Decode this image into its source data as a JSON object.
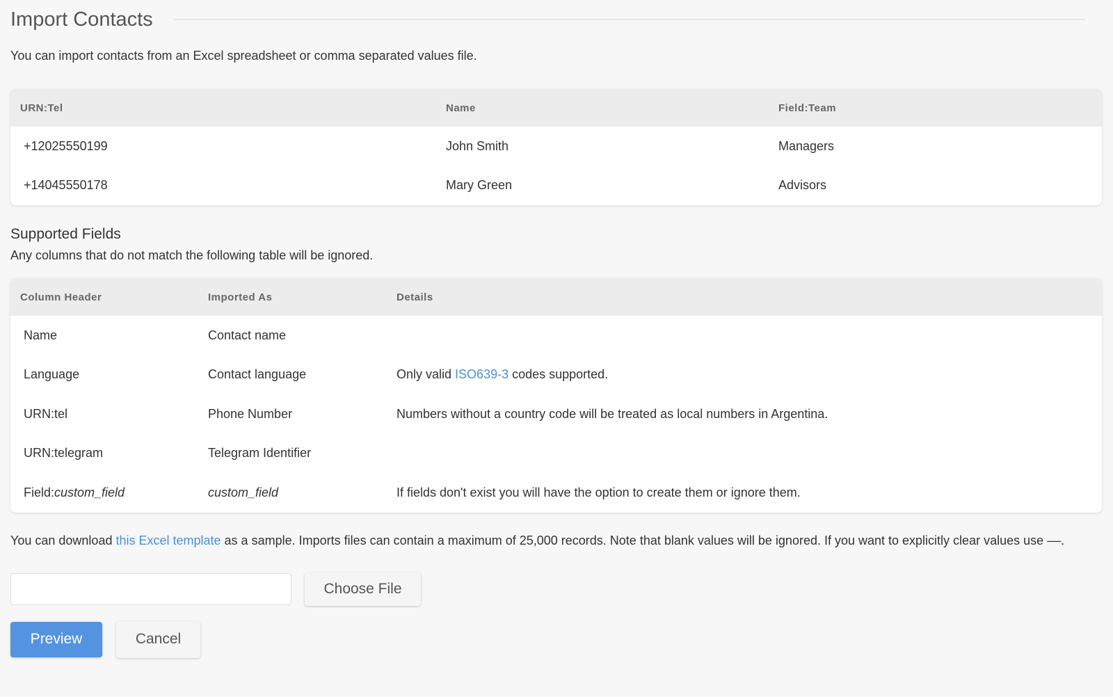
{
  "header": {
    "title": "Import Contacts",
    "intro": "You can import contacts from an Excel spreadsheet or comma separated values file."
  },
  "sample_table": {
    "columns": [
      "URN:Tel",
      "Name",
      "Field:Team"
    ],
    "rows": [
      [
        "+12025550199",
        "John Smith",
        "Managers"
      ],
      [
        "+14045550178",
        "Mary Green",
        "Advisors"
      ]
    ]
  },
  "supported": {
    "title": "Supported Fields",
    "description": "Any columns that do not match the following table will be ignored.",
    "columns": [
      "Column Header",
      "Imported As",
      "Details"
    ],
    "rows": [
      {
        "header": "Name",
        "imported_as": "Contact name",
        "details": ""
      },
      {
        "header": "Language",
        "imported_as": "Contact language",
        "details_prefix": "Only valid ",
        "details_link": "ISO639-3",
        "details_suffix": " codes supported."
      },
      {
        "header": "URN:tel",
        "imported_as": "Phone Number",
        "details": "Numbers without a country code will be treated as local numbers in Argentina."
      },
      {
        "header": "URN:telegram",
        "imported_as": "Telegram Identifier",
        "details": ""
      },
      {
        "header_prefix": "Field:",
        "header_italic": "custom_field",
        "imported_as_italic": "custom_field",
        "details": "If fields don't exist you will have the option to create them or ignore them."
      }
    ]
  },
  "footer": {
    "prefix": "You can download ",
    "link": "this Excel template",
    "suffix": " as a sample. Imports files can contain a maximum of 25,000 records. Note that blank values will be ignored. If you want to explicitly clear values use ––."
  },
  "upload": {
    "file_value": "",
    "choose_label": "Choose File"
  },
  "actions": {
    "preview_label": "Preview",
    "cancel_label": "Cancel"
  },
  "colors": {
    "link": "#4a90d9",
    "primary_button": "#5493e0",
    "background": "#f7f7f7"
  }
}
